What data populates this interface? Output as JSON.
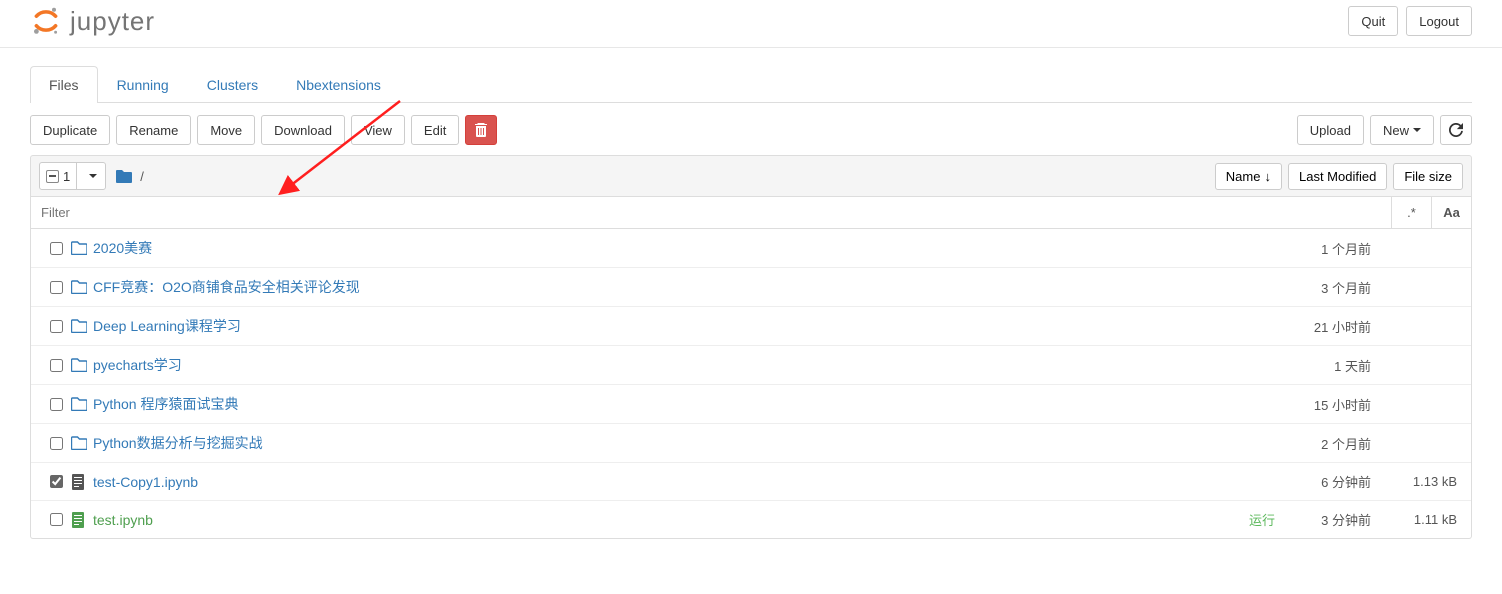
{
  "app": {
    "brand": "jupyter"
  },
  "header": {
    "quit": "Quit",
    "logout": "Logout"
  },
  "tabs": {
    "items": [
      {
        "label": "Files",
        "active": true
      },
      {
        "label": "Running",
        "active": false
      },
      {
        "label": "Clusters",
        "active": false
      },
      {
        "label": "Nbextensions",
        "active": false
      }
    ]
  },
  "toolbar": {
    "duplicate": "Duplicate",
    "rename": "Rename",
    "move": "Move",
    "download": "Download",
    "view": "View",
    "edit": "Edit",
    "upload": "Upload",
    "new": "New"
  },
  "list_header": {
    "selected_count": "1",
    "breadcrumb_sep": "/",
    "name_btn": "Name",
    "last_modified_btn": "Last Modified",
    "file_size_btn": "File size"
  },
  "filter": {
    "placeholder": "Filter",
    "regex_btn": ".*",
    "case_btn": "Aa"
  },
  "files": [
    {
      "type": "folder",
      "name": "2020美赛",
      "modified": "1 个月前",
      "size": "",
      "checked": false,
      "status": ""
    },
    {
      "type": "folder",
      "name": "CFF竞赛：O2O商铺食品安全相关评论发现",
      "modified": "3 个月前",
      "size": "",
      "checked": false,
      "status": ""
    },
    {
      "type": "folder",
      "name": "Deep Learning课程学习",
      "modified": "21 小时前",
      "size": "",
      "checked": false,
      "status": ""
    },
    {
      "type": "folder",
      "name": "pyecharts学习",
      "modified": "1 天前",
      "size": "",
      "checked": false,
      "status": ""
    },
    {
      "type": "folder",
      "name": "Python 程序猿面试宝典",
      "modified": "15 小时前",
      "size": "",
      "checked": false,
      "status": ""
    },
    {
      "type": "folder",
      "name": "Python数据分析与挖掘实战",
      "modified": "2 个月前",
      "size": "",
      "checked": false,
      "status": ""
    },
    {
      "type": "notebook",
      "name": "test-Copy1.ipynb",
      "modified": "6 分钟前",
      "size": "1.13 kB",
      "checked": true,
      "status": "",
      "running": false
    },
    {
      "type": "notebook",
      "name": "test.ipynb",
      "modified": "3 分钟前",
      "size": "1.11 kB",
      "checked": false,
      "status": "运行",
      "running": true
    }
  ]
}
